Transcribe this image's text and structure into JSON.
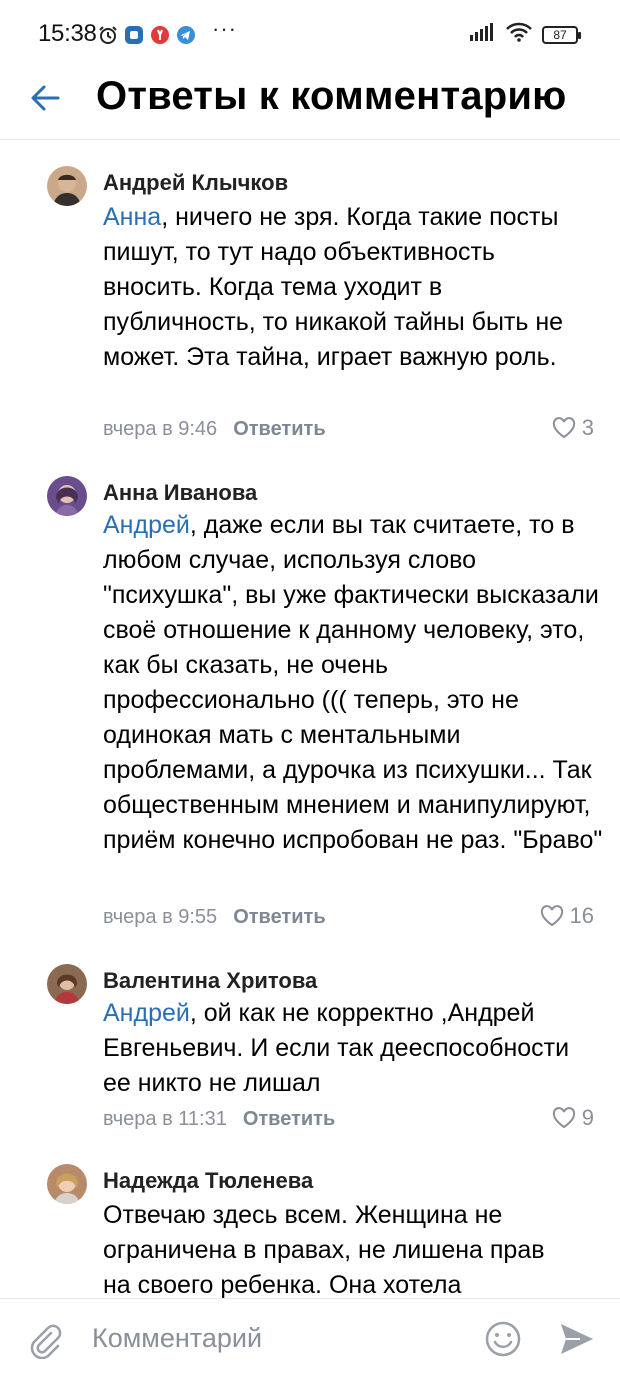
{
  "status_bar": {
    "time": "15:38",
    "battery": "87",
    "more": "···"
  },
  "header": {
    "title": "Ответы к комментарию"
  },
  "comments": [
    {
      "author": "Андрей Клычков",
      "mention": "Анна",
      "text": ", ничего не зря. Когда такие посты пишут, то тут надо объективность вносить. Когда тема уходит в публичность, то никакой тайны быть не может. Эта тайна, играет важную роль.",
      "time": "вчера в 9:46",
      "reply": "Ответить",
      "likes": "3"
    },
    {
      "author": "Анна Иванова",
      "mention": "Андрей",
      "text": ", даже если вы так считаете, то в любом случае, используя слово \"психушка\", вы уже фактически высказали своё отношение к данному человеку, это, как бы сказать, не очень профессионально ((( теперь, это не одинокая мать с ментальными проблемами, а дурочка из психушки... Так общественным мнением и манипулируют, приём конечно испробован не раз. \"Браво\"",
      "time": "вчера в 9:55",
      "reply": "Ответить",
      "likes": "16"
    },
    {
      "author": "Валентина Хритова",
      "mention": "Андрей",
      "text": ", ой как не корректно ,Андрей Евгеньевич. И если так дееспособности ее никто не лишал",
      "time": "вчера в 11:31",
      "reply": "Ответить",
      "likes": "9"
    },
    {
      "author": "Надежда Тюленева",
      "mention": "",
      "text": "Отвечаю здесь всем. Женщина не ограничена в правах, не лишена прав на своего ребенка. Она хотела",
      "time": "",
      "reply": "",
      "likes": ""
    }
  ],
  "composer": {
    "placeholder": "Комментарий"
  },
  "colors": {
    "accent": "#2a6fb5",
    "meta": "#8a8f99",
    "divider": "#e7e8ec"
  }
}
